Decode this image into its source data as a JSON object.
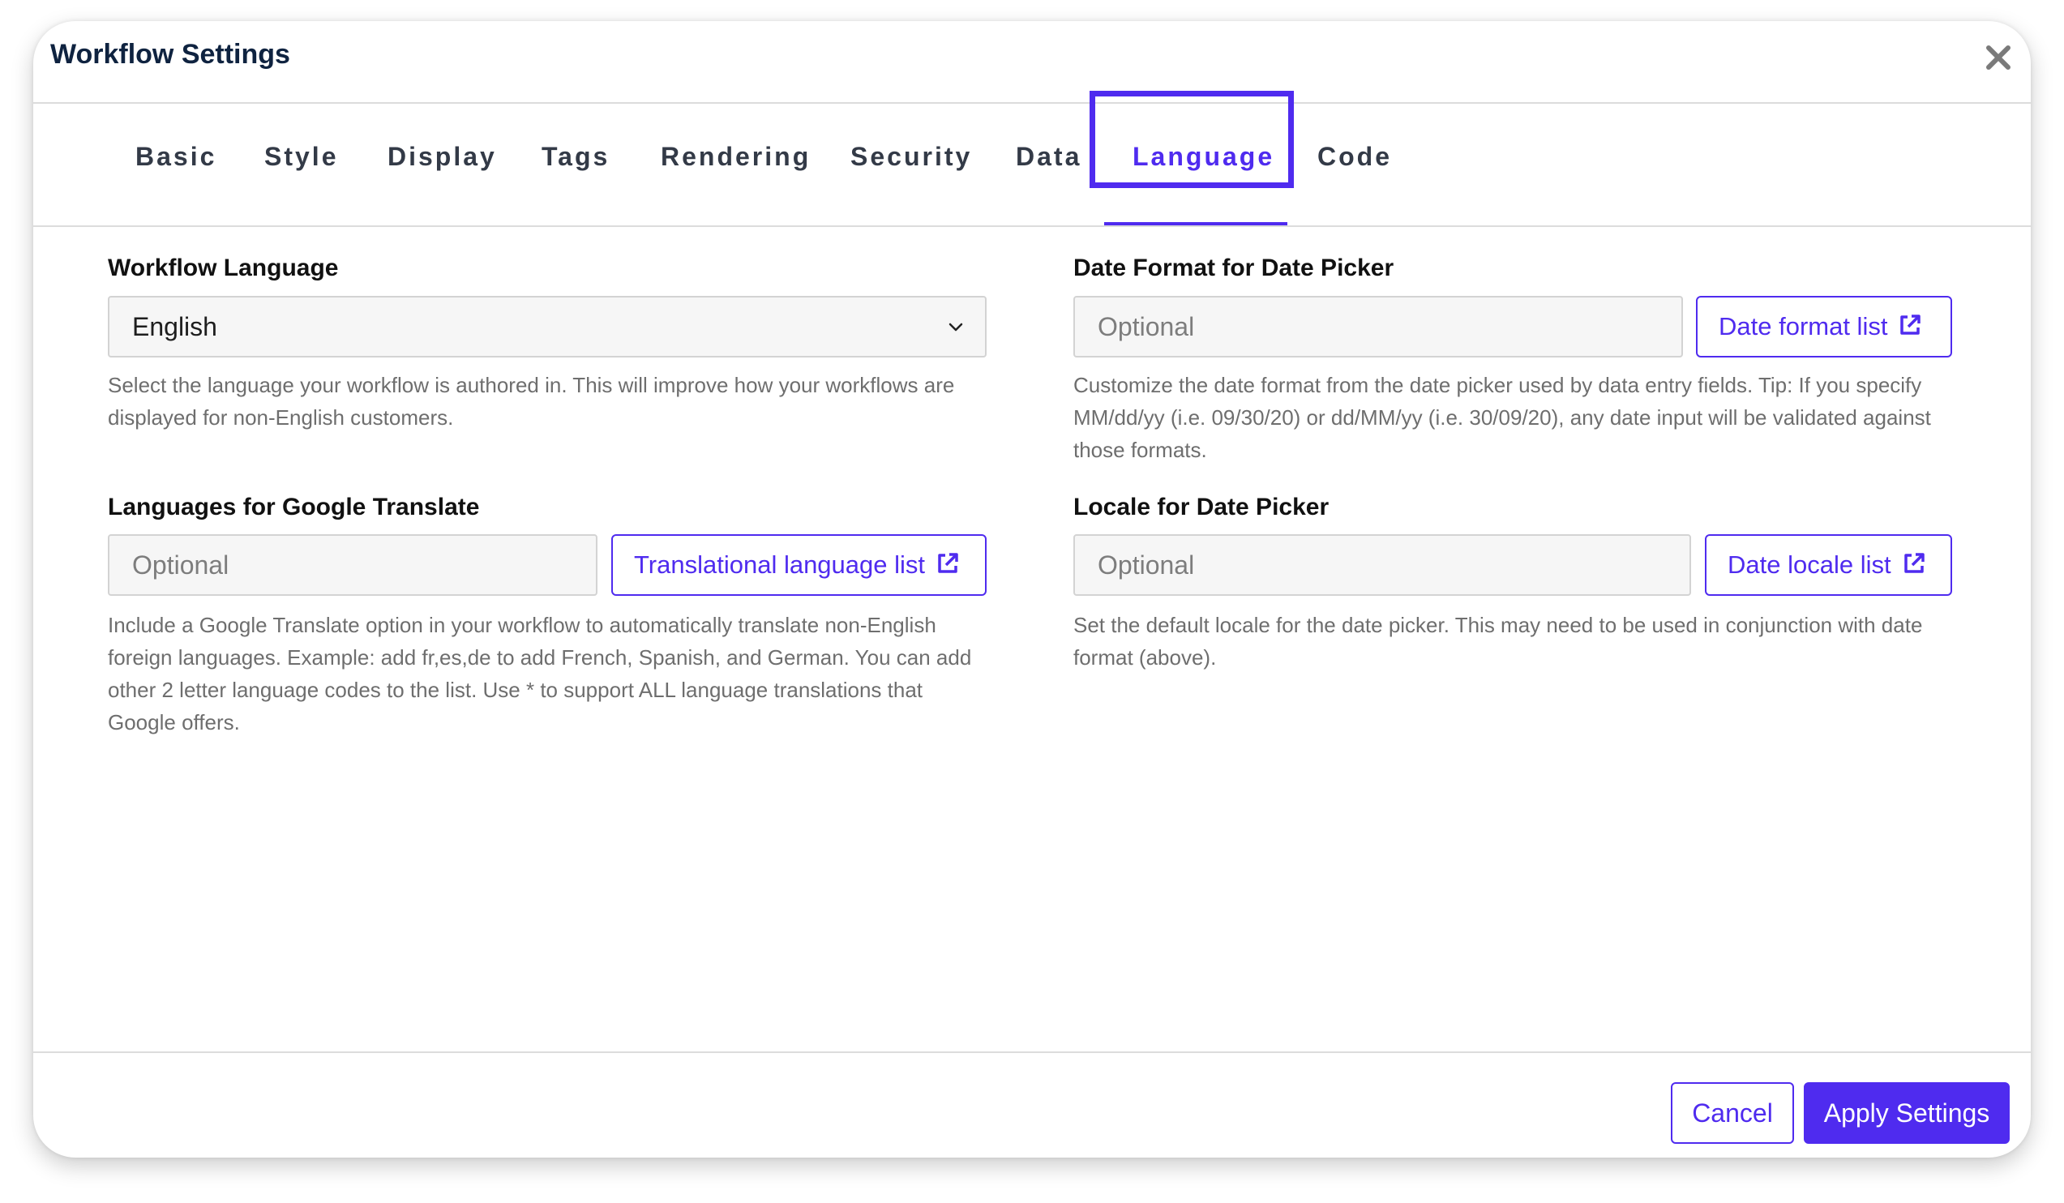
{
  "dialog": {
    "title": "Workflow Settings"
  },
  "tabs": [
    {
      "label": "Basic"
    },
    {
      "label": "Style"
    },
    {
      "label": "Display"
    },
    {
      "label": "Tags"
    },
    {
      "label": "Rendering"
    },
    {
      "label": "Security"
    },
    {
      "label": "Data"
    },
    {
      "label": "Language",
      "active": true
    },
    {
      "label": "Code"
    }
  ],
  "workflow_language": {
    "label": "Workflow Language",
    "value": "English",
    "help": "Select the language your workflow is authored in. This will improve how your workflows are displayed for non-English customers."
  },
  "google_translate": {
    "label": "Languages for Google Translate",
    "placeholder": "Optional",
    "button_label": "Translational language list",
    "help": "Include a Google Translate option in your workflow to automatically translate non-English foreign languages. Example: add fr,es,de to add French, Spanish, and German. You can add other 2 letter language codes to the list. Use * to support ALL language translations that Google offers."
  },
  "date_format": {
    "label": "Date Format for Date Picker",
    "placeholder": "Optional",
    "button_label": "Date format list",
    "help": "Customize the date format from the date picker used by data entry fields. Tip: If you specify MM/dd/yy (i.e. 09/30/20) or dd/MM/yy (i.e. 30/09/20), any date input will be validated against those formats."
  },
  "date_locale": {
    "label": "Locale for Date Picker",
    "placeholder": "Optional",
    "button_label": "Date locale list",
    "help": "Set the default locale for the date picker. This may need to be used in conjunction with date format (above)."
  },
  "footer": {
    "cancel_label": "Cancel",
    "apply_label": "Apply Settings"
  },
  "colors": {
    "accent": "#4f2bef",
    "title": "#0f2340",
    "help_text": "#6e6e6e"
  },
  "icons": {
    "close": "close-icon",
    "dropdown": "chevron-down-icon",
    "external_link": "external-link-icon"
  }
}
